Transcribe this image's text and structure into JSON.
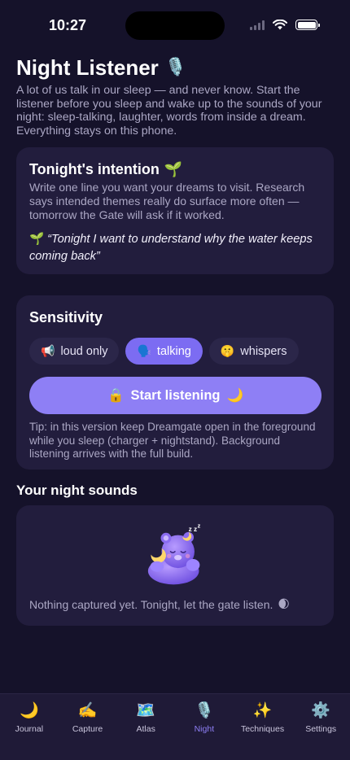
{
  "status": {
    "time": "10:27"
  },
  "header": {
    "title": "Night Listener",
    "title_icon": "🎙️",
    "intro": "A lot of us talk in our sleep — and never know. Start the listener before you sleep and wake up to the sounds of your night: sleep-talking, laughter, words from inside a dream. Everything stays on this phone."
  },
  "intention_card": {
    "title": "Tonight's intention",
    "title_icon": "🌱",
    "text": "Write one line you want your dreams to visit. Research says intended themes really do surface more often — tomorrow the Gate will ask if it worked.",
    "intention_icon": "🌱",
    "intention": "“Tonight I want to understand why the water keeps coming back”"
  },
  "sensitivity_card": {
    "title": "Sensitivity",
    "options": [
      {
        "icon": "📢",
        "label": "loud only"
      },
      {
        "icon": "🗣️",
        "label": "talking"
      },
      {
        "icon": "🤫",
        "label": "whispers"
      }
    ],
    "selected": "talking",
    "start_icon_left": "🔒",
    "start_label": "Start listening",
    "start_icon_right": "🌙",
    "tip": "Tip: in this version keep Dreamgate open in the foreground while you sleep (charger + nightstand). Background listening arrives with the full build."
  },
  "night_sounds": {
    "title": "Your night sounds",
    "empty_text": "Nothing captured yet. Tonight, let the gate listen.",
    "empty_icon": "🌒"
  },
  "tabs": [
    {
      "icon": "🌙",
      "label": "Journal"
    },
    {
      "icon": "✍️",
      "label": "Capture"
    },
    {
      "icon": "🗺️",
      "label": "Atlas"
    },
    {
      "icon": "🎙️",
      "label": "Night"
    },
    {
      "icon": "✨",
      "label": "Techniques"
    },
    {
      "icon": "⚙️",
      "label": "Settings"
    }
  ],
  "active_tab": "Night",
  "colors": {
    "accent": "#8e7ff5",
    "background": "#15122a",
    "card": "#221d3d"
  }
}
